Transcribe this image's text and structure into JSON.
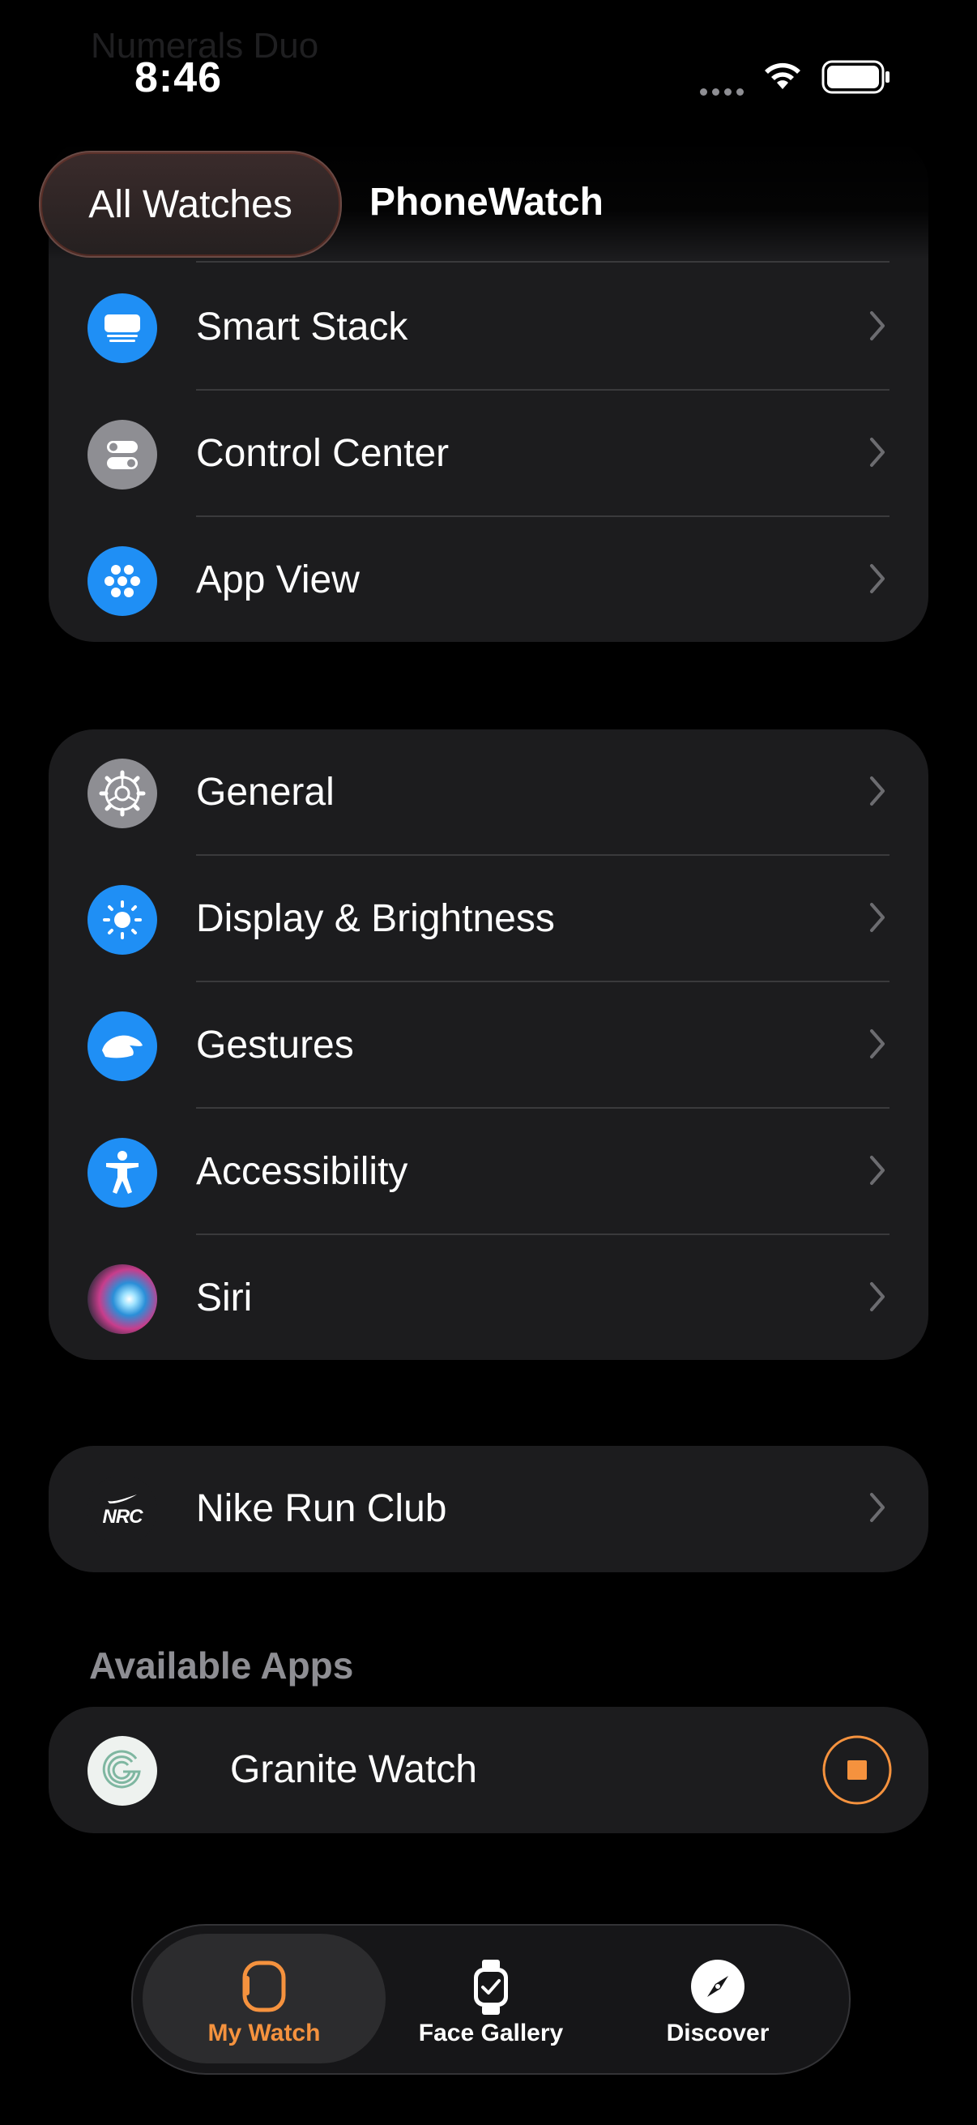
{
  "status_bar": {
    "time": "8:46"
  },
  "ghost_title": "Numerals Duo",
  "header": {
    "pill_label": "All Watches",
    "watch_name": "PhoneWatch"
  },
  "group1": [
    {
      "label": "Smart Stack",
      "icon": "smart-stack-icon",
      "color": "#1f8ff5"
    },
    {
      "label": "Control Center",
      "icon": "control-center-icon",
      "color": "#8e8e93"
    },
    {
      "label": "App View",
      "icon": "app-view-icon",
      "color": "#1f8ff5"
    }
  ],
  "group2": [
    {
      "label": "General",
      "icon": "gear-icon",
      "color": "#8e8e93"
    },
    {
      "label": "Display & Brightness",
      "icon": "sun-icon",
      "color": "#1f8ff5"
    },
    {
      "label": "Gestures",
      "icon": "hand-icon",
      "color": "#1f8ff5"
    },
    {
      "label": "Accessibility",
      "icon": "accessibility-icon",
      "color": "#1f8ff5"
    },
    {
      "label": "Siri",
      "icon": "siri-icon",
      "color": "#5a3a8a"
    }
  ],
  "group3": [
    {
      "label": "Nike Run Club",
      "icon": "nrc-icon",
      "icon_text": "NRC"
    }
  ],
  "available": {
    "heading": "Available Apps",
    "items": [
      {
        "label": "Granite Watch",
        "icon": "granite-g-icon"
      }
    ]
  },
  "tabs": [
    {
      "label": "My Watch",
      "active": true,
      "color": "#f5923e"
    },
    {
      "label": "Face Gallery",
      "active": false
    },
    {
      "label": "Discover",
      "active": false
    }
  ]
}
